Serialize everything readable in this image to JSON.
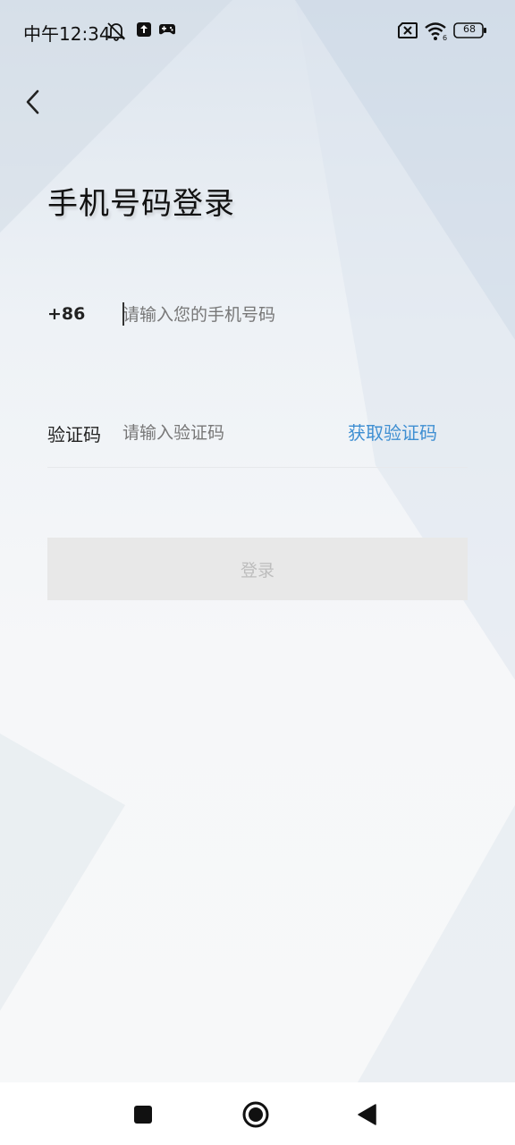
{
  "status_bar": {
    "time": "中午12:34",
    "battery": "68",
    "icons": [
      "mute-icon",
      "upload-icon",
      "gamepad-icon",
      "sim-disabled-icon",
      "wifi-icon",
      "battery-icon"
    ]
  },
  "header": {
    "back_icon": "chevron-left-icon",
    "title": "手机号码登录"
  },
  "phone_field": {
    "country_code": "+86",
    "placeholder": "请输入您的手机号码",
    "value": ""
  },
  "code_field": {
    "label": "验证码",
    "placeholder": "请输入验证码",
    "value": "",
    "get_code_label": "获取验证码"
  },
  "login_button": {
    "label": "登录"
  },
  "nav_bar": {
    "icons": [
      "recent-apps-icon",
      "home-icon",
      "back-icon"
    ]
  },
  "colors": {
    "accent": "#3f8fd2",
    "login_button_bg": "#e8e8e8",
    "login_button_text": "#bdbdbd"
  }
}
